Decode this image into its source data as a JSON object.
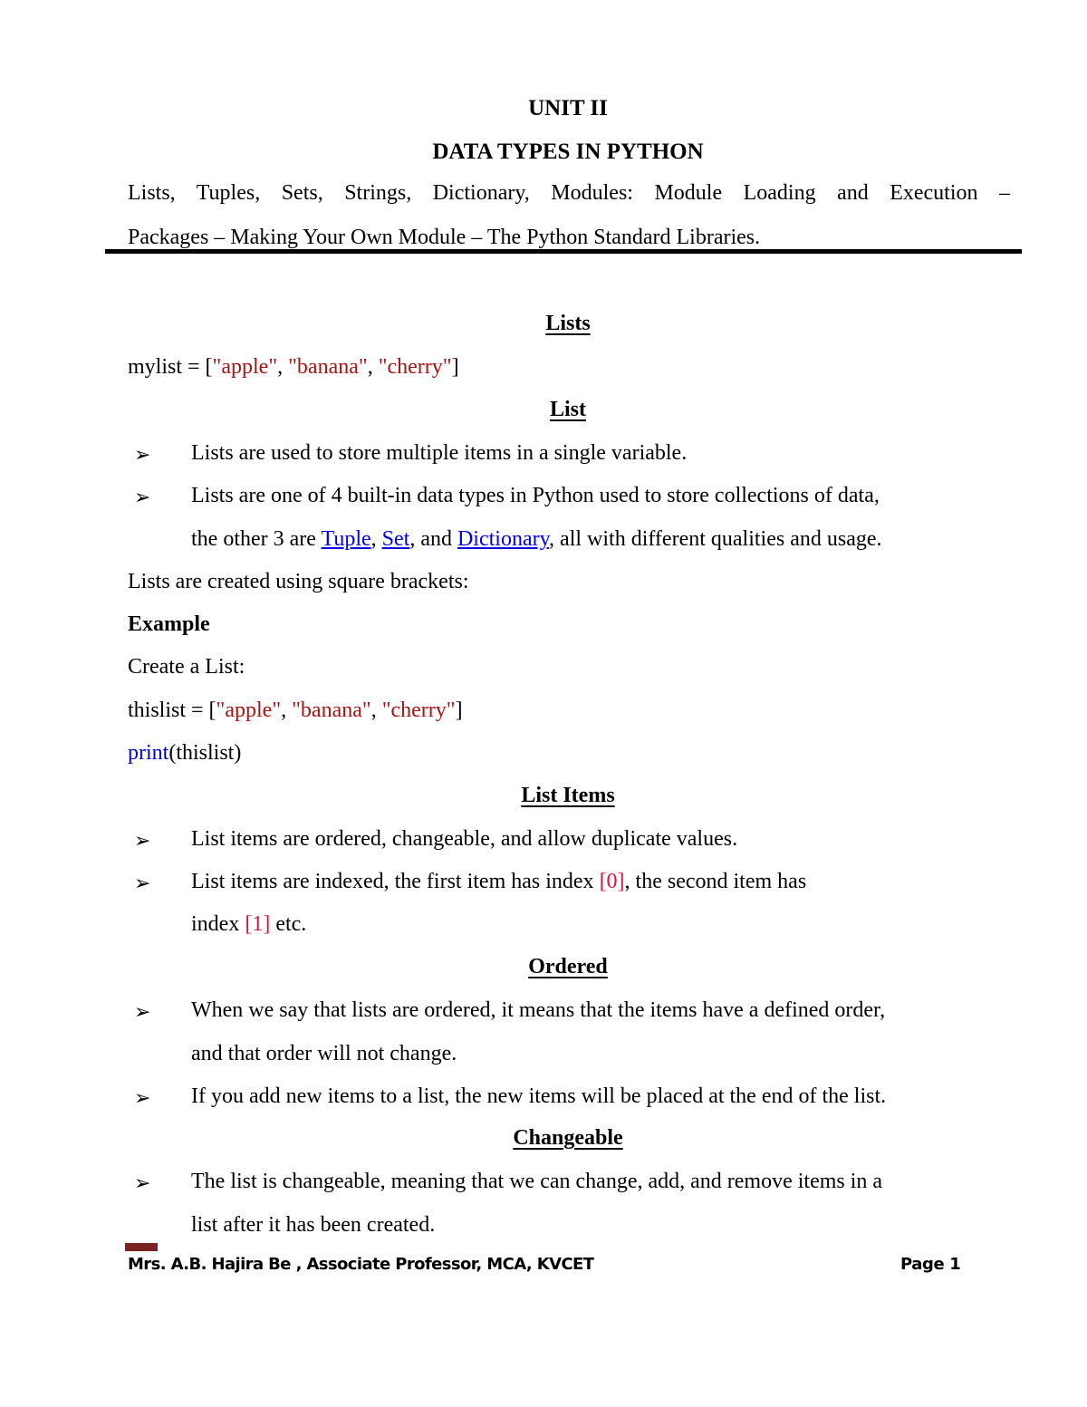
{
  "header": {
    "unit": "UNIT II",
    "title": "DATA TYPES IN PYTHON",
    "syllabus_line1": "Lists, Tuples, Sets, Strings, Dictionary, Modules: Module Loading and Execution –",
    "syllabus_line2": "Packages – Making Your Own Module – The Python Standard Libraries."
  },
  "sections": {
    "lists_heading": "Lists",
    "mylist_code": {
      "var": "mylist = [",
      "s1": "\"apple\"",
      "sep1": ", ",
      "s2": "\"banana\"",
      "sep2": ", ",
      "s3": "\"cherry\"",
      "end": "]"
    },
    "list_heading": "List",
    "list_bullets": {
      "b1": "Lists are used to store multiple items in a single variable.",
      "b2_line1": "Lists are one of 4 built-in data types in Python used to store collections of data,",
      "b2_line2_pre": "the other 3 are ",
      "link_tuple": "Tuple",
      "sep_a": ", ",
      "link_set": "Set",
      "sep_b": ", and ",
      "link_dictionary": "Dictionary",
      "b2_line2_post": ", all with different qualities and usage."
    },
    "created_text": "Lists are created using square brackets:",
    "example_heading": "Example",
    "create_text": "Create a List:",
    "thislist_code": {
      "var": "thislist = [",
      "s1": "\"apple\"",
      "sep1": ", ",
      "s2": "\"banana\"",
      "sep2": ", ",
      "s3": "\"cherry\"",
      "end": "]"
    },
    "print_code": {
      "fn": "print",
      "args": "(thislist)"
    },
    "list_items_heading": "List Items",
    "list_items_bullets": {
      "b1": "List items are ordered, changeable, and allow duplicate values.",
      "b2_pre": "List items are indexed, the first item has index ",
      "b2_idx0": "[0]",
      "b2_post": ", the second item has",
      "b2_line2_pre": "index ",
      "b2_idx1": "[1]",
      "b2_line2_post": " etc."
    },
    "ordered_heading": "Ordered",
    "ordered_bullets": {
      "b1_line1": "When we say that lists are ordered, it means that the items have a defined order,",
      "b1_line2": "and that order will not change.",
      "b2": "If you add new items to a list, the new items will be placed at the end of the list."
    },
    "changeable_heading": "Changeable",
    "changeable_bullets": {
      "b1_line1": "The list is changeable, meaning that we can change, add, and remove items in a",
      "b1_line2": "list after it has been created."
    }
  },
  "bullet_icon": "➢",
  "footer": {
    "author": "Mrs. A.B. Hajira Be , Associate Professor, MCA, KVCET",
    "page": "Page 1"
  },
  "colors": {
    "string_literal": "#a31515",
    "keyword": "#0000cd",
    "index": "#dc143c",
    "link": "#0000ee",
    "footer_marker": "#7b2323"
  }
}
